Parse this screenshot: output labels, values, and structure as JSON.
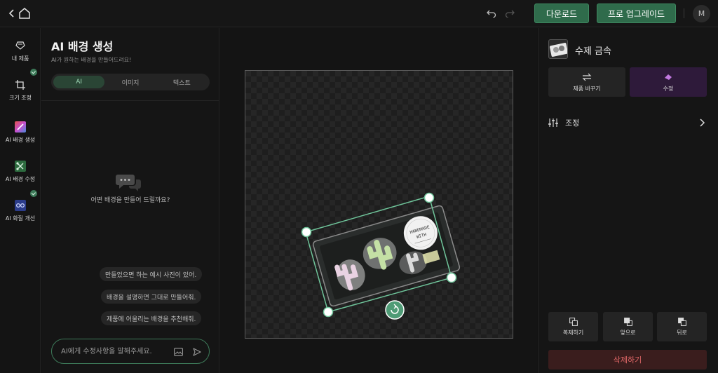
{
  "header": {
    "download_label": "다운로드",
    "upgrade_label": "프로 업그레이드",
    "avatar_initial": "M"
  },
  "rail": {
    "items": [
      {
        "label": "내 제품",
        "icon": "product-icon"
      },
      {
        "label": "크기 조정",
        "icon": "crop-icon"
      },
      {
        "label": "AI 배경 생성",
        "icon": "ai-background-icon"
      },
      {
        "label": "AI 배경 수정",
        "icon": "ai-edit-icon"
      },
      {
        "label": "AI 화질 개선",
        "icon": "ai-enhance-icon"
      }
    ]
  },
  "panel": {
    "title": "AI 배경 생성",
    "subtitle": "AI가 원하는 배경을 만들어드려요!",
    "tabs": [
      "AI",
      "이미지",
      "텍스트"
    ],
    "active_tab": "AI",
    "empty_text": "어떤 배경을 만들어 드릴까요?",
    "suggestions": [
      "만들었으면 하는 예시 사진이 있어.",
      "배경을 설명하면 그대로 만들어줘.",
      "제품에 어울리는 배경을 추천해줘."
    ],
    "input_placeholder": "AI에게 수정사항을 말해주세요."
  },
  "canvas": {
    "product_label_line1": "HANDMADE",
    "product_label_line2": "WITH"
  },
  "right": {
    "product_name": "수제 금속",
    "replace_label": "제품 바꾸기",
    "edit_label": "수정",
    "adjust_label": "조정",
    "duplicate_label": "복제하기",
    "front_label": "앞으로",
    "back_label": "뒤로",
    "delete_label": "삭제하기"
  },
  "colors": {
    "accent_green": "#2f6b4b",
    "selection_teal": "#6fc49a",
    "edit_purple": "#2e1a3a",
    "delete_red": "#e06767"
  }
}
